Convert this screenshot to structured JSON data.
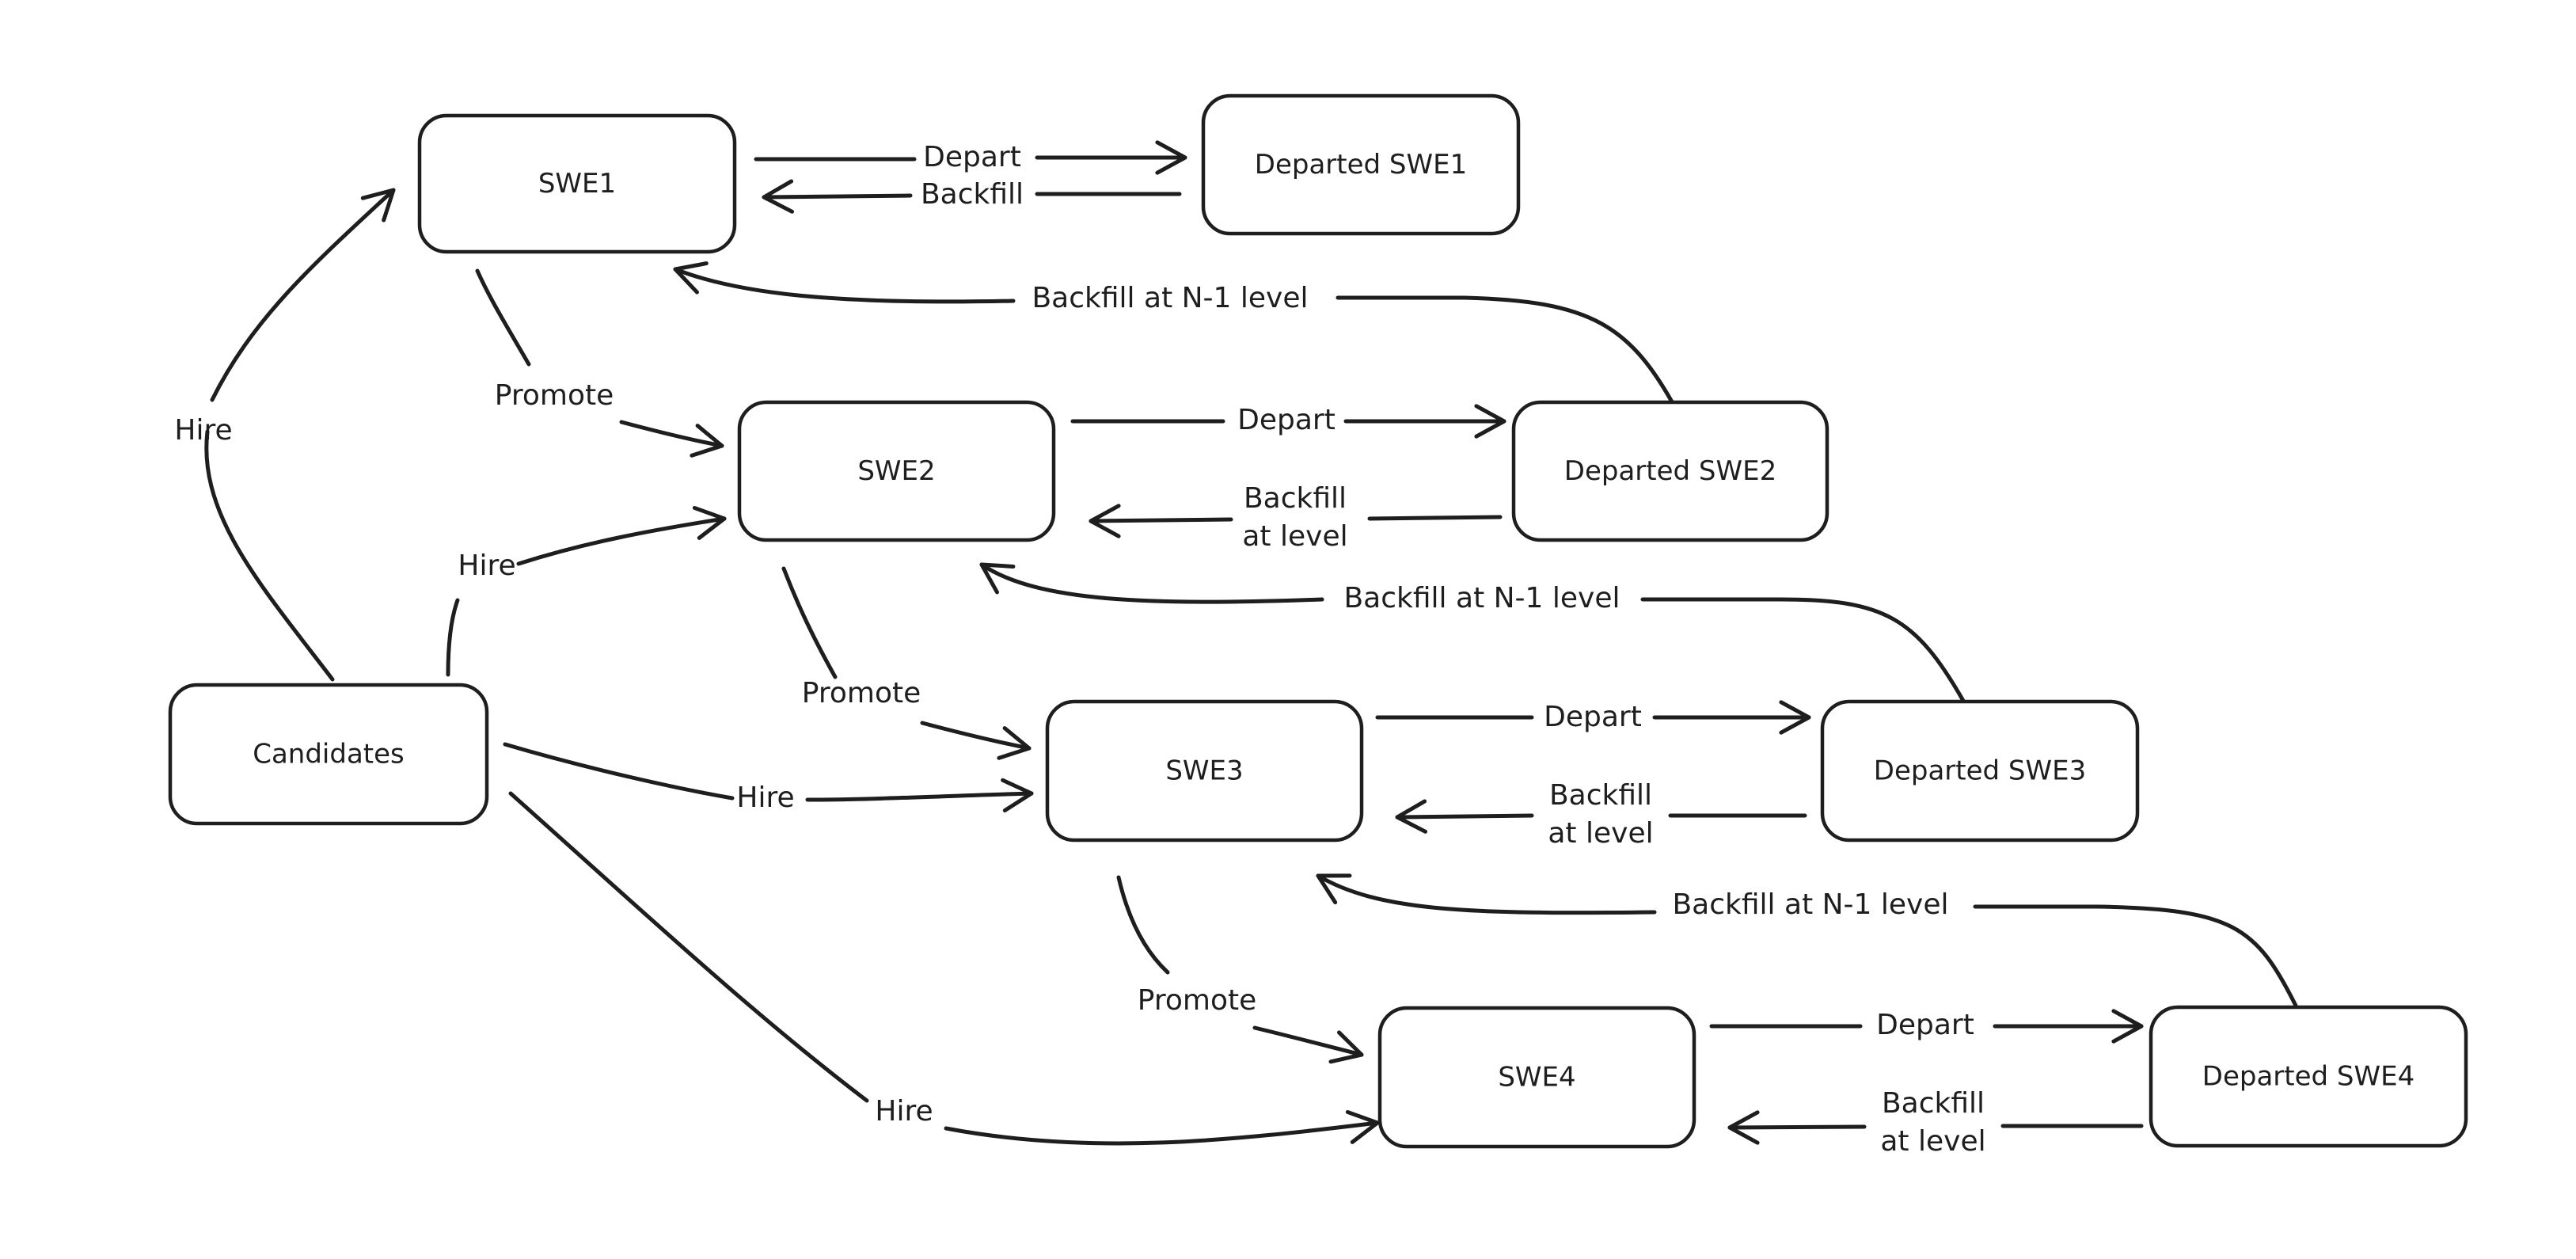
{
  "diagram": {
    "type": "state-diagram",
    "nodes": [
      {
        "id": "swe1",
        "label": "SWE1"
      },
      {
        "id": "departed_swe1",
        "label": "Departed SWE1"
      },
      {
        "id": "swe2",
        "label": "SWE2"
      },
      {
        "id": "departed_swe2",
        "label": "Departed SWE2"
      },
      {
        "id": "candidates",
        "label": "Candidates"
      },
      {
        "id": "swe3",
        "label": "SWE3"
      },
      {
        "id": "departed_swe3",
        "label": "Departed SWE3"
      },
      {
        "id": "swe4",
        "label": "SWE4"
      },
      {
        "id": "departed_swe4",
        "label": "Departed SWE4"
      }
    ],
    "edges": [
      {
        "id": "e1",
        "from": "candidates",
        "to": "swe1",
        "label": "Hire"
      },
      {
        "id": "e2",
        "from": "candidates",
        "to": "swe2",
        "label": "Hire"
      },
      {
        "id": "e3",
        "from": "candidates",
        "to": "swe3",
        "label": "Hire"
      },
      {
        "id": "e4",
        "from": "candidates",
        "to": "swe4",
        "label": "Hire"
      },
      {
        "id": "e5",
        "from": "swe1",
        "to": "swe2",
        "label": "Promote"
      },
      {
        "id": "e6",
        "from": "swe2",
        "to": "swe3",
        "label": "Promote"
      },
      {
        "id": "e7",
        "from": "swe3",
        "to": "swe4",
        "label": "Promote"
      },
      {
        "id": "e8",
        "from": "swe1",
        "to": "departed_swe1",
        "label": "Depart"
      },
      {
        "id": "e9",
        "from": "departed_swe1",
        "to": "swe1",
        "label": "Backfill"
      },
      {
        "id": "e10",
        "from": "swe2",
        "to": "departed_swe2",
        "label": "Depart"
      },
      {
        "id": "e11",
        "from": "departed_swe2",
        "to": "swe2",
        "label": "Backfill\nat level"
      },
      {
        "id": "e12",
        "from": "departed_swe2",
        "to": "swe1",
        "label": "Backfill at N-1 level"
      },
      {
        "id": "e13",
        "from": "swe3",
        "to": "departed_swe3",
        "label": "Depart"
      },
      {
        "id": "e14",
        "from": "departed_swe3",
        "to": "swe3",
        "label": "Backfill\nat level"
      },
      {
        "id": "e15",
        "from": "departed_swe3",
        "to": "swe2",
        "label": "Backfill at N-1 level"
      },
      {
        "id": "e16",
        "from": "swe4",
        "to": "departed_swe4",
        "label": "Depart"
      },
      {
        "id": "e17",
        "from": "departed_swe4",
        "to": "swe4",
        "label": "Backfill\nat level"
      },
      {
        "id": "e18",
        "from": "departed_swe4",
        "to": "swe3",
        "label": "Backfill at N-1 level"
      }
    ]
  },
  "style": {
    "stroke_color": "#1e1e1e",
    "background_color": "#ffffff"
  }
}
